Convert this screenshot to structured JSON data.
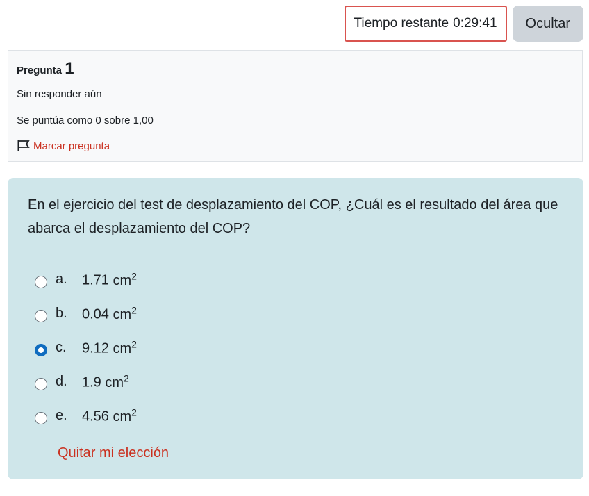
{
  "timer": {
    "label": "Tiempo restante",
    "time": "0:29:41",
    "hide_label": "Ocultar"
  },
  "info": {
    "title": "Pregunta",
    "number": "1",
    "status": "Sin responder aún",
    "grade": "Se puntúa como 0 sobre 1,00",
    "flag_label": "Marcar pregunta"
  },
  "question": {
    "text": "En el ejercicio del test de desplazamiento del COP, ¿Cuál es el resultado del área que abarca el desplazamiento del COP?",
    "unit": "cm",
    "unit_exp": "2",
    "answers": [
      {
        "letter": "a.",
        "value": "1.71",
        "selected": false
      },
      {
        "letter": "b.",
        "value": "0.04",
        "selected": false
      },
      {
        "letter": "c.",
        "value": "9.12",
        "selected": true
      },
      {
        "letter": "d.",
        "value": "1.9",
        "selected": false
      },
      {
        "letter": "e.",
        "value": "4.56",
        "selected": false
      }
    ],
    "clear_label": "Quitar mi elección"
  },
  "colors": {
    "accent": "#0f6cbf",
    "link": "#ca3120",
    "content_bg": "#cfe6ea",
    "timer_border": "#d9534f"
  },
  "icons": {
    "flag": "flag-icon",
    "radio": "radio-icon"
  }
}
